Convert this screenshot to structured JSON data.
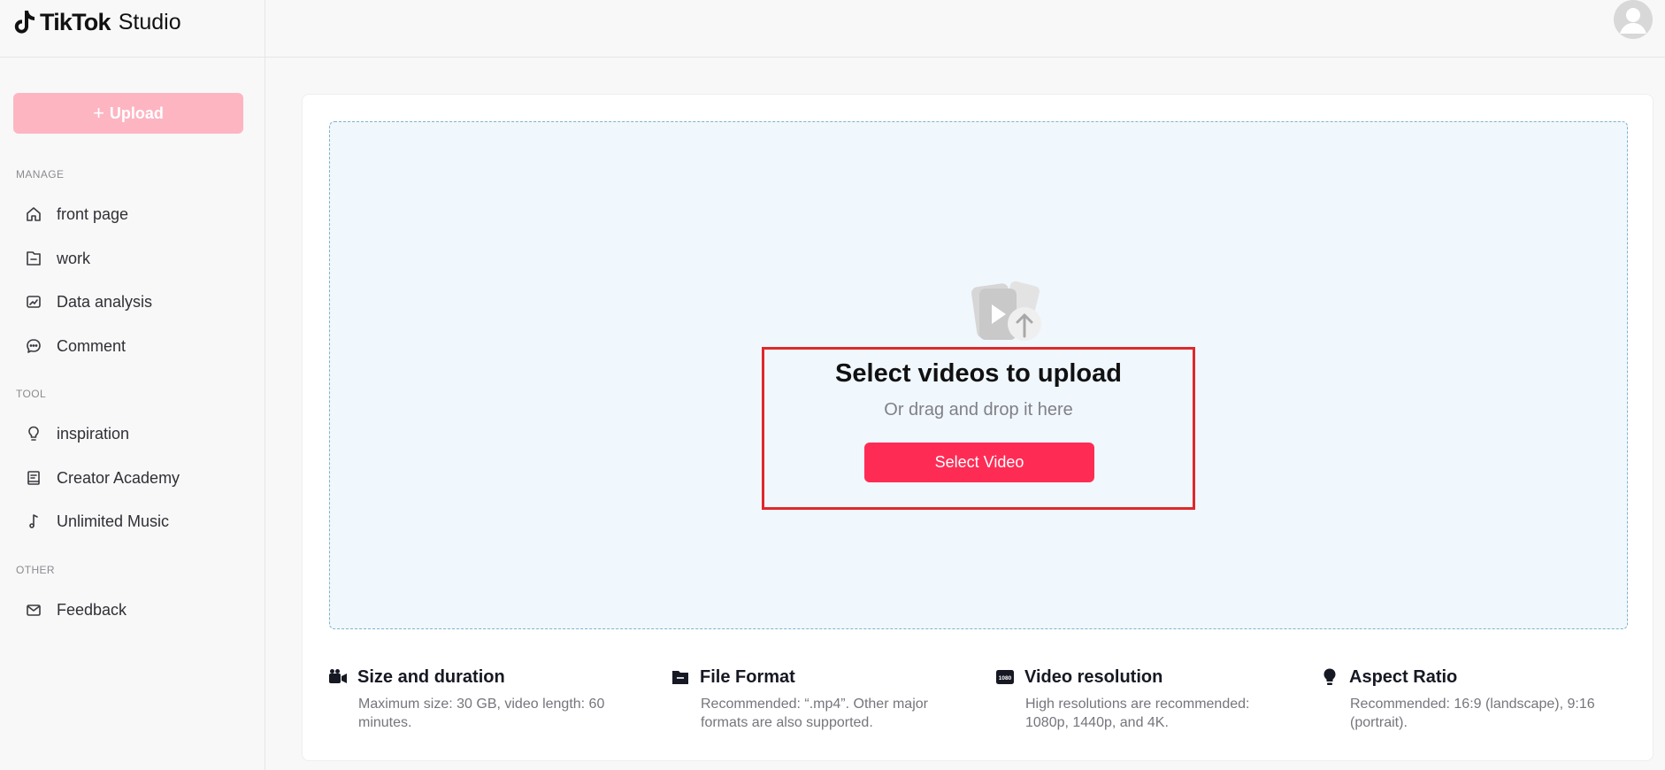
{
  "app": {
    "brand": "TikTok",
    "product": "Studio"
  },
  "sidebar": {
    "upload_label": "Upload",
    "sections": {
      "manage": "MANAGE",
      "tool": "TOOL",
      "other": "OTHER"
    },
    "items": [
      {
        "label": "front page",
        "icon": "home-icon"
      },
      {
        "label": "work",
        "icon": "folder-icon"
      },
      {
        "label": "Data analysis",
        "icon": "chart-icon"
      },
      {
        "label": "Comment",
        "icon": "comment-icon"
      },
      {
        "label": "inspiration",
        "icon": "lightbulb-icon"
      },
      {
        "label": "Creator Academy",
        "icon": "book-icon"
      },
      {
        "label": "Unlimited Music",
        "icon": "music-note-icon"
      },
      {
        "label": "Feedback",
        "icon": "mail-icon"
      }
    ]
  },
  "dropzone": {
    "title": "Select videos to upload",
    "subtitle": "Or drag and drop it here",
    "button_label": "Select Video"
  },
  "info": [
    {
      "title": "Size and duration",
      "desc": "Maximum size: 30 GB, video length: 60 minutes.",
      "icon": "video-camera-icon"
    },
    {
      "title": "File Format",
      "desc": "Recommended: “.mp4”. Other major formats are also supported.",
      "icon": "folder-icon"
    },
    {
      "title": "Video resolution",
      "desc": "High resolutions are recommended: 1080p, 1440p, and 4K.",
      "icon": "resolution-icon",
      "badge": "1080"
    },
    {
      "title": "Aspect Ratio",
      "desc": "Recommended: 16:9 (landscape), 9:16 (portrait).",
      "icon": "lightbulb-icon"
    }
  ],
  "colors": {
    "accent": "#fe2c55",
    "upload_button_disabled": "#fdb5c2",
    "dropzone_bg": "#f0f7fd",
    "highlight_border": "#e0282c"
  }
}
